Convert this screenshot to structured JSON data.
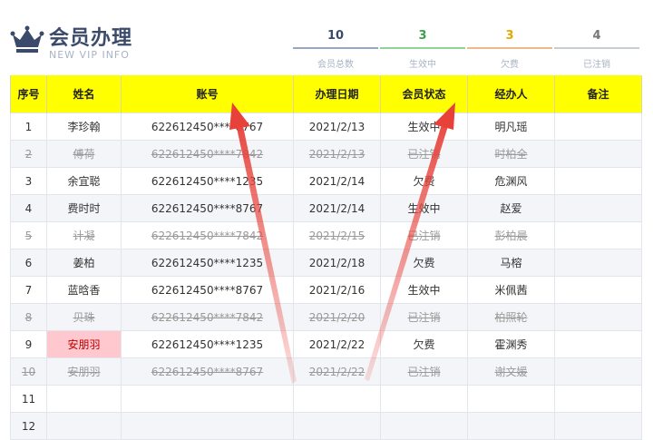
{
  "header": {
    "title": "会员办理",
    "subtitle": "NEW VIP  INFO"
  },
  "stats": [
    {
      "value": "10",
      "label": "会员总数"
    },
    {
      "value": "3",
      "label": "生效中"
    },
    {
      "value": "3",
      "label": "欠费"
    },
    {
      "value": "4",
      "label": "已注销"
    }
  ],
  "table": {
    "columns": [
      "序号",
      "姓名",
      "账号",
      "办理日期",
      "会员状态",
      "经办人",
      "备注"
    ],
    "rows": [
      {
        "no": "1",
        "name": "李珍翰",
        "account": "622612450****8767",
        "date": "2021/2/13",
        "status": "生效中",
        "handler": "明凡瑶",
        "note": ""
      },
      {
        "no": "2",
        "name": "傅荷",
        "account": "622612450****7842",
        "date": "2021/2/13",
        "status": "已注销",
        "handler": "时柏全",
        "note": ""
      },
      {
        "no": "3",
        "name": "余宜聪",
        "account": "622612450****1235",
        "date": "2021/2/14",
        "status": "欠费",
        "handler": "危渊风",
        "note": ""
      },
      {
        "no": "4",
        "name": "费时时",
        "account": "622612450****8767",
        "date": "2021/2/14",
        "status": "生效中",
        "handler": "赵爱",
        "note": ""
      },
      {
        "no": "5",
        "name": "计凝",
        "account": "622612450****7842",
        "date": "2021/2/15",
        "status": "已注销",
        "handler": "彭柏晨",
        "note": ""
      },
      {
        "no": "6",
        "name": "姜柏",
        "account": "622612450****1235",
        "date": "2021/2/18",
        "status": "欠费",
        "handler": "马榕",
        "note": ""
      },
      {
        "no": "7",
        "name": "蓝晗香",
        "account": "622612450****8767",
        "date": "2021/2/16",
        "status": "生效中",
        "handler": "米佩茜",
        "note": ""
      },
      {
        "no": "8",
        "name": "贝珠",
        "account": "622612450****7842",
        "date": "2021/2/20",
        "status": "已注销",
        "handler": "柏照轮",
        "note": ""
      },
      {
        "no": "9",
        "name": "安朋羽",
        "account": "622612450****1235",
        "date": "2021/2/22",
        "status": "欠费",
        "handler": "霍渊秀",
        "note": ""
      },
      {
        "no": "10",
        "name": "安朋羽",
        "account": "622612450****8767",
        "date": "2021/2/22",
        "status": "已注销",
        "handler": "谢文媛",
        "note": ""
      },
      {
        "no": "11",
        "name": "",
        "account": "",
        "date": "",
        "status": "",
        "handler": "",
        "note": ""
      },
      {
        "no": "12",
        "name": "",
        "account": "",
        "date": "",
        "status": "",
        "handler": "",
        "note": ""
      }
    ]
  },
  "colors": {
    "header_fill": "#ffff00",
    "highlight_fill": "#ffc7ce",
    "highlight_text": "#c00000",
    "arrow": "#e8413a"
  }
}
